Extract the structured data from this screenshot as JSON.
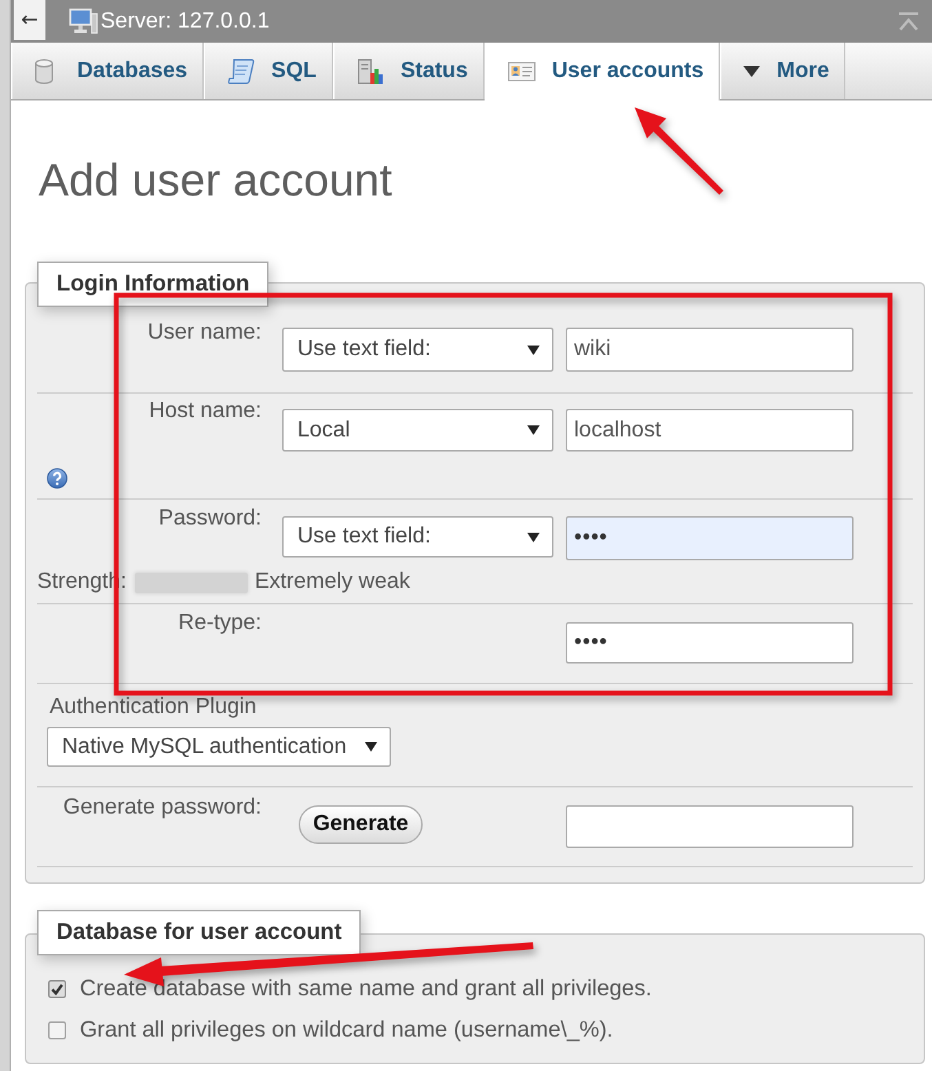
{
  "top_bar": {
    "back": "←",
    "title": "Server: 127.0.0.1"
  },
  "tabs": [
    {
      "label": "Databases",
      "kind": "database",
      "selected": false
    },
    {
      "label": "SQL",
      "kind": "sql",
      "selected": false
    },
    {
      "label": "Status",
      "kind": "status",
      "selected": false
    },
    {
      "label": "User accounts",
      "kind": "accounts",
      "selected": true
    },
    {
      "label": "More",
      "kind": "menu",
      "selected": false
    }
  ],
  "heading": "Add user account",
  "login_information": {
    "legend": "Login Information",
    "user_name": {
      "label": "User name:",
      "select": "Use text field:",
      "value": "wiki",
      "autofilled": false
    },
    "host_name": {
      "label": "Host name:",
      "select": "Local",
      "value": "localhost",
      "autofilled": false
    },
    "password": {
      "label": "Password:",
      "select": "Use text field:",
      "value": "••••",
      "autofilled": true
    },
    "strength": {
      "label": "Strength:",
      "text": "Extremely weak"
    },
    "retype": {
      "label": "Re-type:",
      "value": "••••",
      "autofilled": false
    },
    "authentication_plugin": {
      "label": "Authentication Plugin",
      "select": "Native MySQL authentication"
    },
    "generate_password": {
      "label": "Generate password:",
      "button": "Generate"
    }
  },
  "database_for_user_account": {
    "legend": "Database for user account",
    "options": [
      {
        "label": "Create database with same name and grant all privileges.",
        "checked": true
      },
      {
        "label": "Grant all privileges on wildcard name (username\\_%).",
        "checked": false
      }
    ]
  }
}
